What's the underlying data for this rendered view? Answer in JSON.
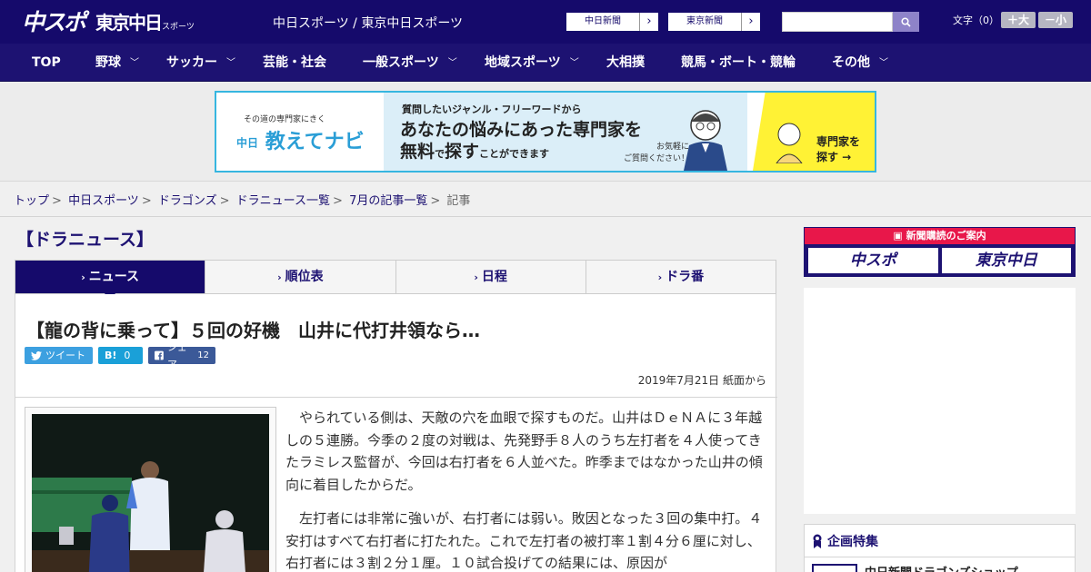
{
  "header": {
    "logo_chuspo": "中スポ",
    "logo_tokyo": "東京中日",
    "logo_tokyo_sub": "スポーツ",
    "site_names": "中日スポーツ / 東京中日スポーツ",
    "ext_link_1": "中日新聞",
    "ext_link_2": "東京新聞",
    "font_label": "文字（0）",
    "font_larger": "＋大",
    "font_smaller": "－小"
  },
  "nav": {
    "items": [
      {
        "label": "TOP"
      },
      {
        "label": "野球"
      },
      {
        "label": "サッカー"
      },
      {
        "label": "芸能・社会"
      },
      {
        "label": "一般スポーツ"
      },
      {
        "label": "地域スポーツ"
      },
      {
        "label": "大相撲"
      },
      {
        "label": "競馬・ボート・競輪"
      },
      {
        "label": "その他"
      }
    ]
  },
  "ad": {
    "small_text": "その道の専門家にきく",
    "brand": "教えてナビ",
    "brand_prefix": "中日",
    "line1": "質問したいジャンル・フリーワードから",
    "line2": "あなたの悩みにあった専門家を",
    "line3_a": "無料",
    "line3_b": "で",
    "line3_c": "探す",
    "line3_d": "ことができます",
    "note": "お気軽に\nご質問ください！",
    "cta": "専門家を\n探す →"
  },
  "breadcrumb": {
    "items": [
      "トップ",
      "中日スポーツ",
      "ドラゴンズ",
      "ドラニュース一覧",
      "7月の記事一覧"
    ],
    "current": "記事"
  },
  "section_title": "【ドラニュース】",
  "tabs": [
    {
      "label": "ニュース"
    },
    {
      "label": "順位表"
    },
    {
      "label": "日程"
    },
    {
      "label": "ドラ番"
    }
  ],
  "article": {
    "headline": "【龍の背に乗って】５回の好機　山井に代打井領なら…",
    "tweet_label": "ツイート",
    "hatena_label": "B!",
    "hatena_count": "0",
    "share_label": "シェア",
    "share_count": "12",
    "date": "2019年7月21日 紙面から",
    "paragraphs": [
      "やられている側は、天敵の穴を血眼で探すものだ。山井はＤｅＮＡに３年越しの５連勝。今季の２度の対戦は、先発野手８人のうち左打者を４人使ってきたラミレス監督が、今回は右打者を６人並べた。昨季まではなかった山井の傾向に着目したからだ。",
      "左打者には非常に強いが、右打者には弱い。敗因となった３回の集中打。４安打はすべて右打者に打たれた。これで左打者の被打率１割４分６厘に対し、右打者には３割２分１厘。１０試合投げての結果には、原因が"
    ]
  },
  "sidebar": {
    "subscribe_head": "新聞購読のご案内",
    "subscribe_logo_1": "中スポ",
    "subscribe_logo_2": "東京中日",
    "feature_title": "企画特集",
    "feature_item": "中日新聞ドラゴンズショップ"
  }
}
